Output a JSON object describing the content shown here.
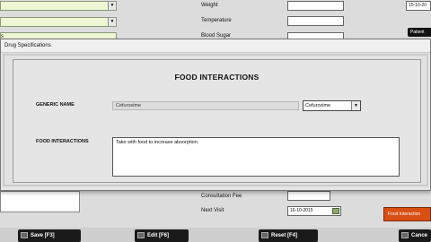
{
  "background": {
    "labels": {
      "weight": "Weight",
      "temperature": "Temperature",
      "blood_sugar": "Blood Sugar",
      "consultation_fee": "Consultation Fee",
      "next_visit": "Next Visit"
    },
    "visit_date_top": "15-10-20",
    "next_visit_date": "16-10-2015",
    "patient_button": "Patient",
    "food_interaction_button": "Food Interaction",
    "partial_label": "s"
  },
  "dialog": {
    "title": "Drug Specifications",
    "heading": "FOOD INTERACTIONS",
    "generic_name_label": "GENERIC NAME",
    "generic_name_value": "Cefuroxime",
    "drug_select_value": "Cefuroxime",
    "food_interactions_label": "FOOD INTERACTIONS",
    "food_interactions_text": "Take with food to increase absorption."
  },
  "bottom_bar": {
    "save_label": "Save [F3]",
    "edit_label": "Edit [F6]",
    "reset_label": "Reset [F4]",
    "cancel_label": "Cance"
  }
}
